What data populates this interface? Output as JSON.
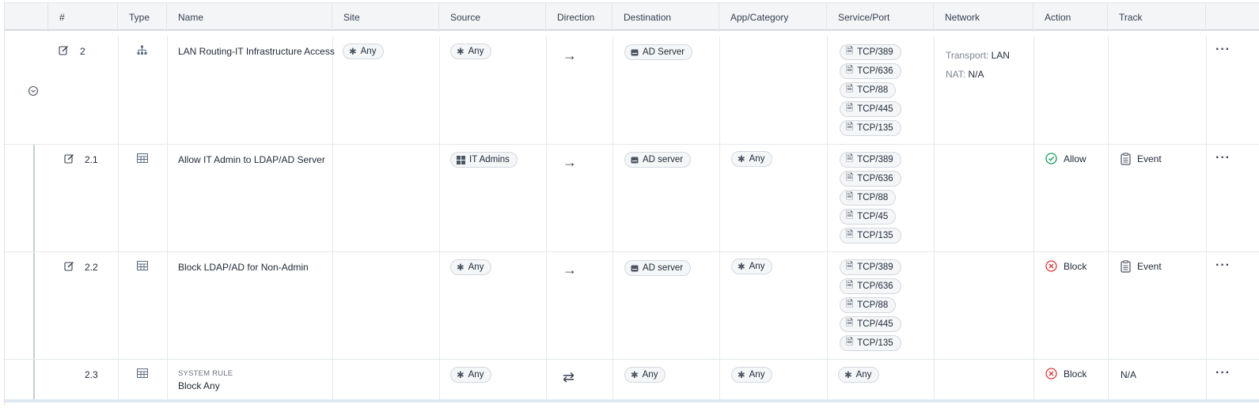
{
  "columns": [
    "#",
    "Type",
    "Name",
    "Site",
    "Source",
    "Direction",
    "Destination",
    "App/Category",
    "Service/Port",
    "Network",
    "Action",
    "Track"
  ],
  "rows": [
    {
      "num": "2",
      "name": "LAN Routing-IT Infrastructure Access",
      "site": "Any",
      "source": "Any",
      "direction": "→",
      "destination": "AD Server",
      "services": [
        "TCP/389",
        "TCP/636",
        "TCP/88",
        "TCP/445",
        "TCP/135"
      ],
      "network_transport_label": "Transport:",
      "network_transport_value": "LAN",
      "network_nat_label": "NAT:",
      "network_nat_value": "N/A"
    },
    {
      "num": "2.1",
      "name": "Allow IT Admin to LDAP/AD Server",
      "source": "IT Admins",
      "direction": "→",
      "destination": "AD server",
      "app": "Any",
      "services": [
        "TCP/389",
        "TCP/636",
        "TCP/88",
        "TCP/45",
        "TCP/135"
      ],
      "action": "Allow",
      "track": "Event"
    },
    {
      "num": "2.2",
      "name": "Block LDAP/AD for Non-Admin",
      "source": "Any",
      "direction": "→",
      "destination": "AD server",
      "app": "Any",
      "services": [
        "TCP/389",
        "TCP/636",
        "TCP/88",
        "TCP/445",
        "TCP/135"
      ],
      "action": "Block",
      "track": "Event"
    },
    {
      "num": "2.3",
      "system_label": "SYSTEM RULE",
      "name": "Block Any",
      "source": "Any",
      "direction": "⇄",
      "destination": "Any",
      "app": "Any",
      "service": "Any",
      "action": "Block",
      "track": "N/A"
    }
  ],
  "colors": {
    "allow": "#1a9c5b",
    "block": "#d83b3b",
    "icon": "#5b6b80"
  }
}
